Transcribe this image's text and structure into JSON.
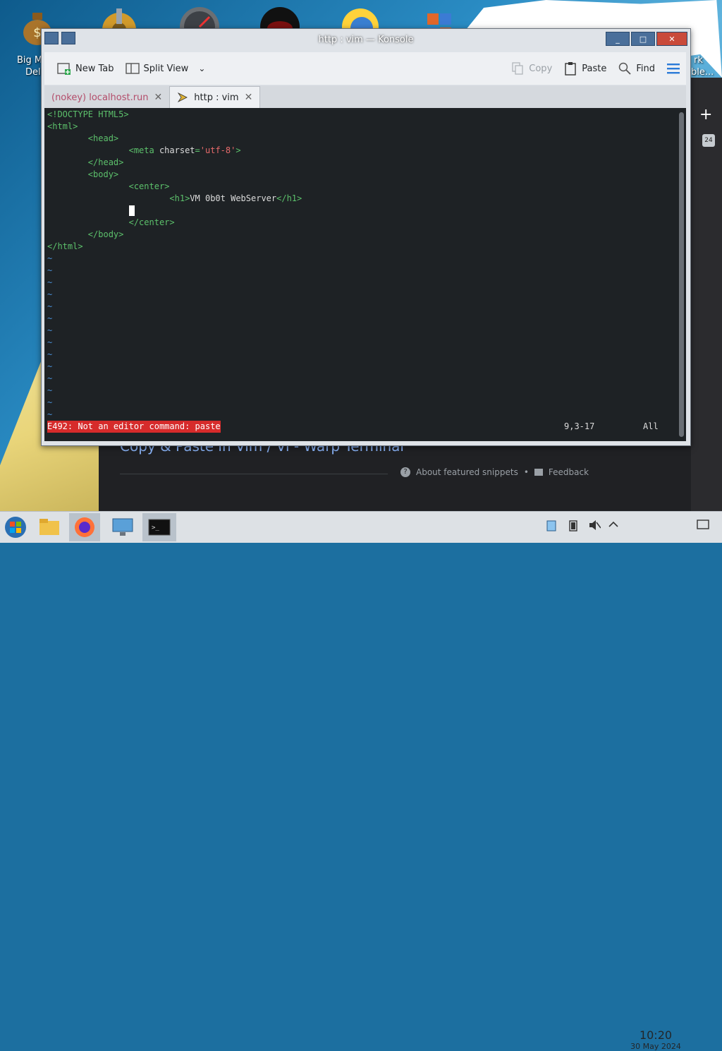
{
  "desktop": {
    "icon_labels": [
      "Big M",
      "Dell",
      "rk",
      "ble..."
    ]
  },
  "browser": {
    "heading": "Copy & Paste in Vim / Vi - Warp Terminal",
    "about_snippets": "About featured snippets",
    "separator": "•",
    "feedback": "Feedback",
    "side_plus": "+",
    "badge_count": "24"
  },
  "window": {
    "title": "http : vim — Konsole",
    "minimize": "_",
    "maximize": "□",
    "close": "✕"
  },
  "toolbar": {
    "new_tab": "New Tab",
    "split_view": "Split View",
    "copy": "Copy",
    "paste": "Paste",
    "find": "Find"
  },
  "tabs": [
    {
      "label": "(nokey) localhost.run",
      "close": "✕"
    },
    {
      "label": "http : vim",
      "close": "✕"
    }
  ],
  "terminal": {
    "lines": [
      {
        "indent": "",
        "parts": [
          [
            "tag",
            "<!DOCTYPE HTML5>"
          ]
        ]
      },
      {
        "indent": "",
        "parts": [
          [
            "tag",
            "<html>"
          ]
        ]
      },
      {
        "indent": "        ",
        "parts": [
          [
            "tag",
            "<head>"
          ]
        ]
      },
      {
        "indent": "                ",
        "parts": [
          [
            "tag",
            "<meta "
          ],
          [
            "txt",
            "charset"
          ],
          [
            "tag",
            "="
          ],
          [
            "str",
            "'utf-8'"
          ],
          [
            "tag",
            ">"
          ]
        ]
      },
      {
        "indent": "        ",
        "parts": [
          [
            "tag",
            "</head>"
          ]
        ]
      },
      {
        "indent": "        ",
        "parts": [
          [
            "tag",
            "<body>"
          ]
        ]
      },
      {
        "indent": "                ",
        "parts": [
          [
            "tag",
            "<center>"
          ]
        ]
      },
      {
        "indent": "                        ",
        "parts": [
          [
            "tag",
            "<h1>"
          ],
          [
            "txt",
            "VM 0b0t WebServer"
          ],
          [
            "tag",
            "</h1>"
          ]
        ]
      },
      {
        "indent": "                ",
        "parts": [
          [
            "cursor",
            ""
          ]
        ]
      },
      {
        "indent": "                ",
        "parts": [
          [
            "tag",
            "</center>"
          ]
        ]
      },
      {
        "indent": "        ",
        "parts": [
          [
            "tag",
            "</body>"
          ]
        ]
      },
      {
        "indent": "",
        "parts": [
          [
            "tag",
            "</html>"
          ]
        ]
      }
    ],
    "tilde": "~",
    "tilde_count": 14,
    "error": "E492: Not an editor command: paste",
    "position": "9,3-17",
    "scroll": "All"
  },
  "taskbar": {
    "time": "10:20",
    "date": "30 May 2024"
  }
}
